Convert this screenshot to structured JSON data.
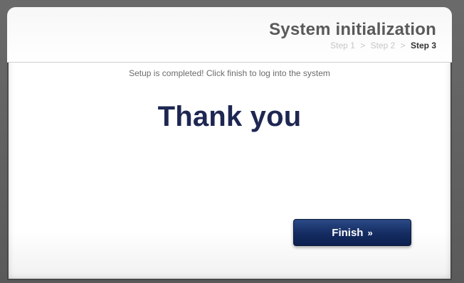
{
  "header": {
    "title": "System initialization",
    "steps": {
      "step1": "Step 1",
      "separator1": ">",
      "step2": "Step 2",
      "separator2": ">",
      "step3": "Step 3",
      "active_step": "Step 3"
    }
  },
  "content": {
    "message": "Setup is completed! Click finish to log into the system",
    "thank_you": "Thank you"
  },
  "actions": {
    "finish_label": "Finish",
    "finish_glyph": "»"
  },
  "colors": {
    "background": "#5f5f5f",
    "title": "#5a5a5a",
    "step_inactive": "#c6c6c6",
    "step_active": "#333333",
    "thank_you": "#1e2752",
    "button": "#142c61"
  }
}
